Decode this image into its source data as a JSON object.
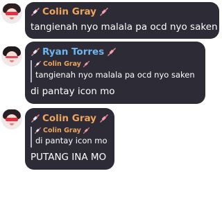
{
  "colors": {
    "bubble": "#2c2b36",
    "colin_name": "#f0a45c",
    "ryan_name": "#6fb7ef",
    "icon": "#e07c8a"
  },
  "messages": [
    {
      "author": "Colin Gray",
      "author_icon": "syringe-icon",
      "text": "tangienah nyo malala pa ocd nyo saken"
    },
    {
      "author": "Ryan Torres",
      "author_icon": "syringe-icon",
      "reply": {
        "author": "Colin Gray",
        "text": "tangienah nyo malala pa ocd nyo saken"
      },
      "text": "di pantay icon mo"
    },
    {
      "author": "Colin Gray",
      "author_icon": "syringe-icon",
      "reply": {
        "author": "Colin Gray",
        "text": "di pantay icon mo"
      },
      "text": "PUTANG INA MO"
    }
  ]
}
